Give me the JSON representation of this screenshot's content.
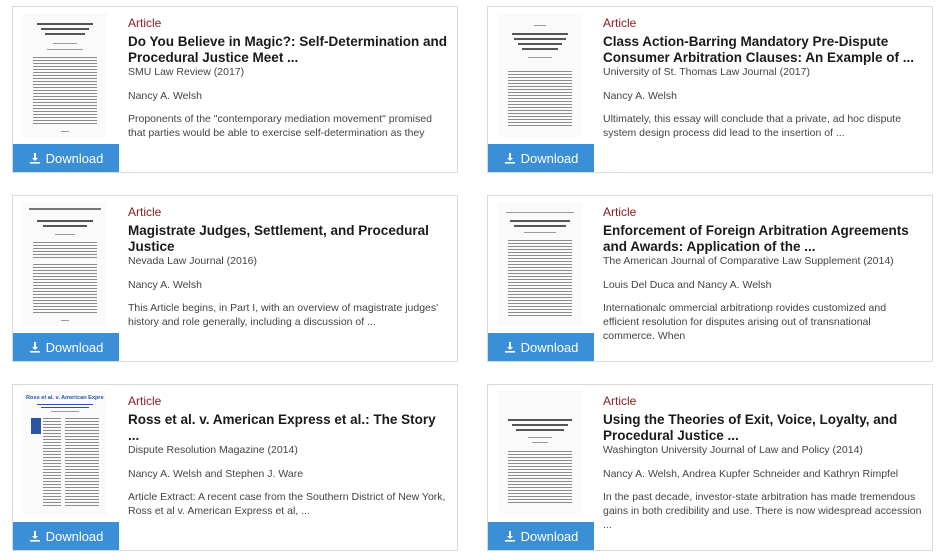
{
  "cards": [
    {
      "type": "Article",
      "title": "Do You Believe in Magic?: Self-Determination and Procedural Justice Meet ...",
      "journal": "SMU Law Review (2017)",
      "authors": "Nancy A. Welsh",
      "excerpt": "Proponents of the \"contemporary mediation movement\" promised that parties would be able to exercise self-determination as they",
      "download_label": "Download"
    },
    {
      "type": "Article",
      "title": "Class Action-Barring Mandatory Pre-Dispute Consumer Arbitration Clauses: An Example of ...",
      "journal": "University of St. Thomas Law Journal (2017)",
      "authors": "Nancy A. Welsh",
      "excerpt": "Ultimately, this essay will conclude that a private, ad hoc dispute system design process did lead to the insertion of ...",
      "download_label": "Download"
    },
    {
      "type": "Article",
      "title": "Magistrate Judges, Settlement, and Procedural Justice",
      "journal": "Nevada Law Journal (2016)",
      "authors": "Nancy A. Welsh",
      "excerpt": "This Article begins, in Part I, with an overview of magistrate judges' history and role generally, including a discussion of ...",
      "download_label": "Download"
    },
    {
      "type": "Article",
      "title": "Enforcement of Foreign Arbitration Agreements and Awards: Application of the ...",
      "journal": "The American Journal of Comparative Law Supplement (2014)",
      "authors": "Louis Del Duca and Nancy A. Welsh",
      "excerpt": "Internationalc ommercial arbitrationp rovides customized and efficient resolution for disputes arising out of transnational commerce. When",
      "download_label": "Download"
    },
    {
      "type": "Article",
      "title": "Ross et al. v. American Express et al.: The Story ...",
      "journal": "Dispute Resolution Magazine (2014)",
      "authors": "Nancy A. Welsh and Stephen J. Ware",
      "excerpt": "Article Extract: A recent case from the Southern District of New York, Ross et al v. American Express et al, ...",
      "download_label": "Download"
    },
    {
      "type": "Article",
      "title": "Using the Theories of Exit, Voice, Loyalty, and Procedural Justice ...",
      "journal": "Washington University Journal of Law and Policy (2014)",
      "authors": "Nancy A. Welsh, Andrea Kupfer Schneider and Kathryn Rimpfel",
      "excerpt": "In the past decade, investor-state arbitration has made tremendous gains in both credibility and use. There is now widespread accession ...",
      "download_label": "Download"
    }
  ],
  "thumbnail_text": {
    "ross_header": "Ross et al. v. American Express et al."
  },
  "colors": {
    "publication_type": "#8b1a1a",
    "download_button": "#3a8fd6",
    "card_border": "#d9d9d9"
  },
  "icons": {
    "download": "download-icon"
  }
}
